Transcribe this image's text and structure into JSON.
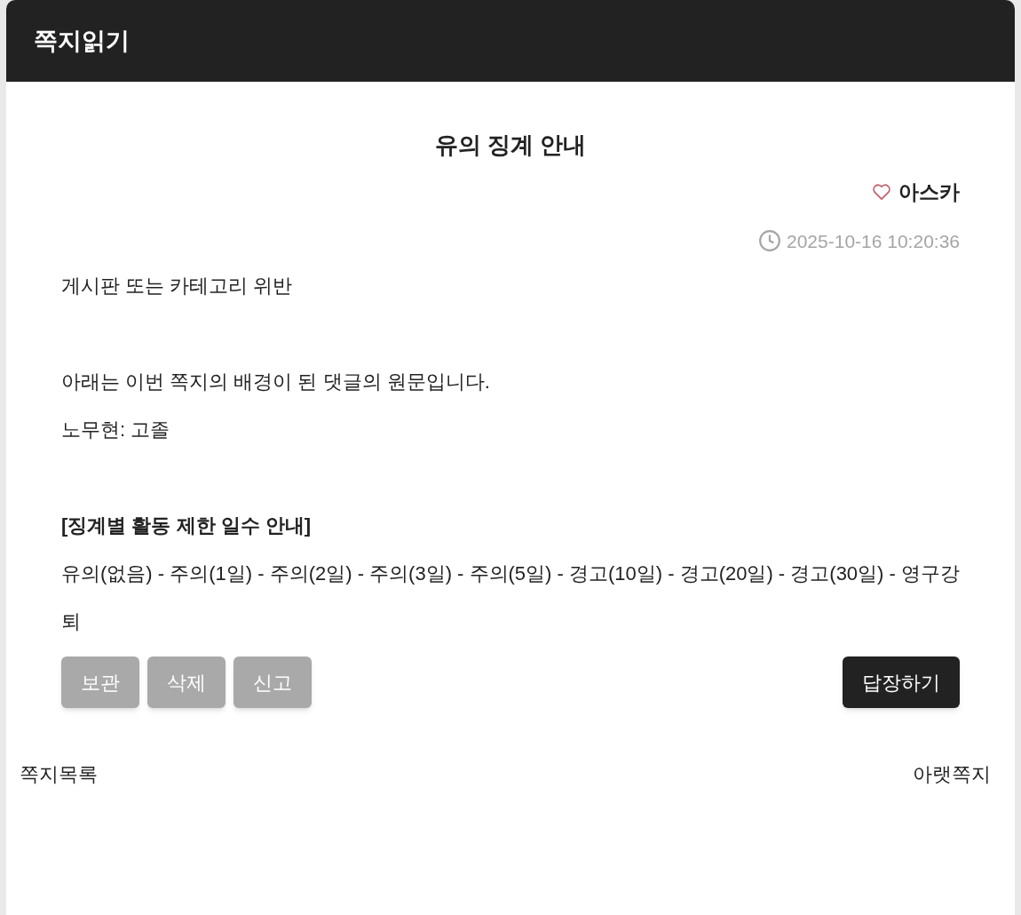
{
  "window": {
    "title": "쪽지읽기"
  },
  "message": {
    "subject": "유의 징계 안내",
    "sender": "아스카",
    "date": "2025-10-16 10:20:36",
    "body": [
      {
        "kind": "text",
        "text": "게시판 또는 카테고리 위반"
      },
      {
        "kind": "break"
      },
      {
        "kind": "text",
        "text": "아래는 이번 쪽지의 배경이 된 댓글의 원문입니다."
      },
      {
        "kind": "text",
        "text": "노무현: 고졸"
      },
      {
        "kind": "break"
      },
      {
        "kind": "heading",
        "text": "[징계별 활동 제한 일수 안내]"
      },
      {
        "kind": "text",
        "text": "유의(없음) - 주의(1일) - 주의(2일) - 주의(3일) - 주의(5일) - 경고(10일) - 경고(20일) - 경고(30일) - 영구강퇴"
      }
    ]
  },
  "actions": [
    "보관",
    "삭제",
    "신고"
  ],
  "reply_button": "답장하기",
  "footer": {
    "list_link": "쪽지목록",
    "next_link": "아랫쪽지"
  }
}
